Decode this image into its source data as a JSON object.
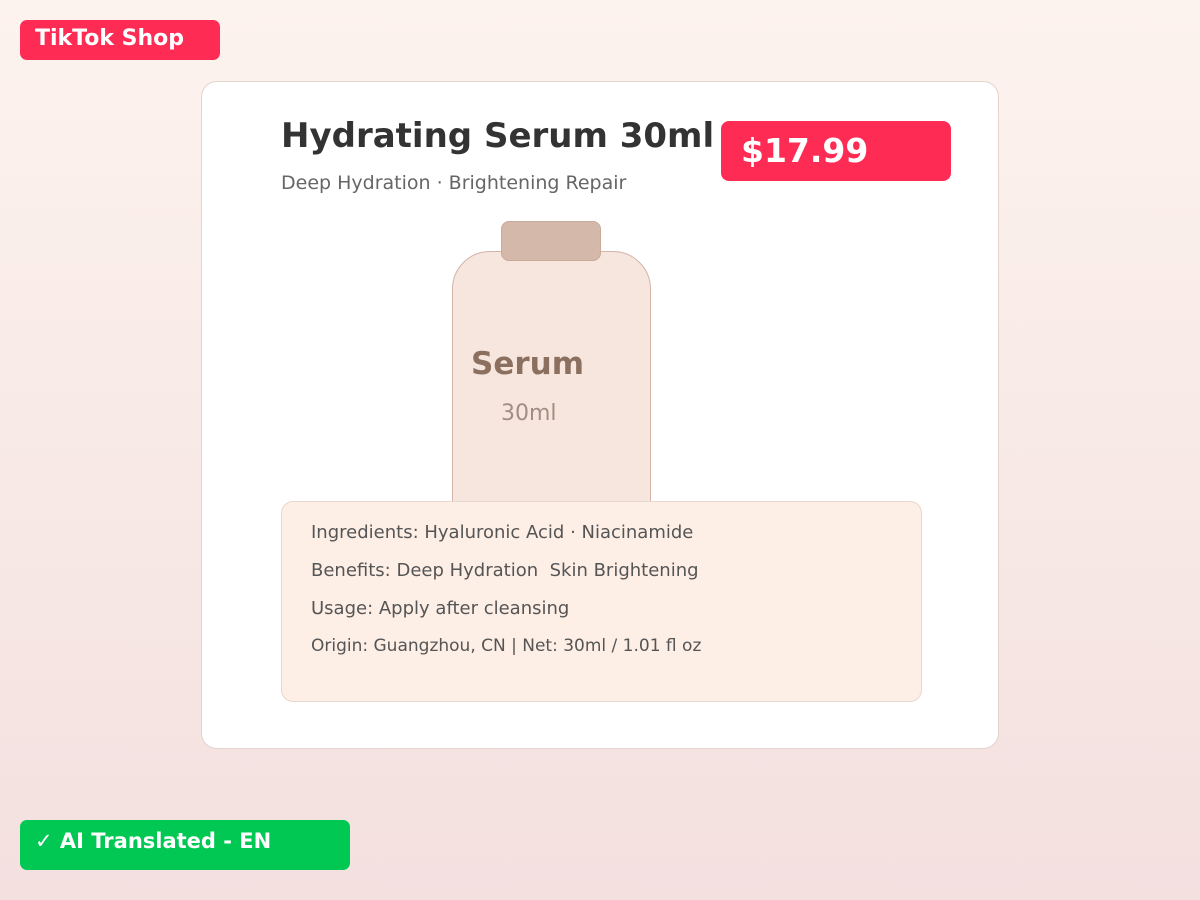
{
  "header": {
    "brand_label": "TikTok Shop"
  },
  "product": {
    "title": "Hydrating Serum 30ml",
    "subtitle": "Deep Hydration · Brightening Repair",
    "price": "$17.99",
    "bottle": {
      "label_name": "Serum",
      "label_volume": "30ml"
    },
    "details": [
      "Ingredients: Hyaluronic Acid · Niacinamide",
      "Benefits: Deep Hydration  Skin Brightening",
      "Usage: Apply after cleansing",
      "Origin: Guangzhou, CN | Net: 30ml / 1.01 fl oz"
    ]
  },
  "footer": {
    "translation_badge": "✓ AI Translated - EN"
  },
  "colors": {
    "brand_accent": "#fe2c55",
    "success_green": "#00c853",
    "bottle_fill": "#f7e6de",
    "bottle_cap": "#d4b8aa",
    "info_panel_fill": "#fdeee6"
  }
}
